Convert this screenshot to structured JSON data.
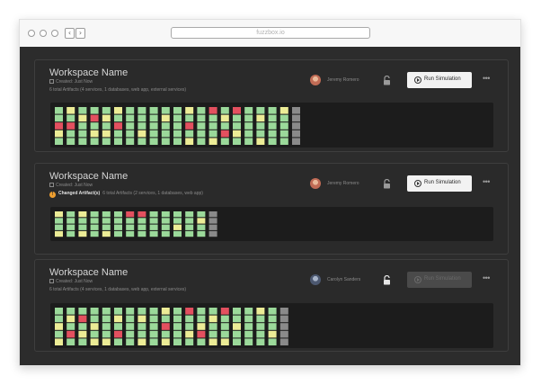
{
  "browser": {
    "url": "fuzzbox.io",
    "back_glyph": "‹",
    "forward_glyph": "›"
  },
  "colors": {
    "green": "#9bd99a",
    "yellow": "#ecec96",
    "red": "#e3505f",
    "gray": "#8a8a8a",
    "button_bg": "#f2f2f2",
    "content_bg": "#2c2c2c"
  },
  "icons": {
    "calendar": "calendar-icon",
    "lock": "lock-icon",
    "play": "play-icon",
    "more": "more-icon",
    "warning": "warning-icon"
  },
  "workspaces": [
    {
      "title": "Workspace Name",
      "created": "Created: Just Now",
      "changed_badge": "",
      "changed_label": "",
      "artifacts": "6 total Artifacts (4 services, 1 databases, web app, external services)",
      "user_name": "Jeremy Romero",
      "lock_state": "unlocked",
      "run_label": "Run Simulation",
      "run_enabled": true,
      "more_label": "•••",
      "columns": [
        "GGRYG",
        "YGRGG",
        "GYGGG",
        "GRGYG",
        "GYGYG",
        "YGRGG",
        "GGGGG",
        "GGGYG",
        "GGGGG",
        "GYGGG",
        "GGGGG",
        "YGRGY",
        "GGGGG",
        "RGGGY",
        "GYGRG",
        "RGGYG",
        "GGGGG",
        "GYGGY",
        "GGGGG",
        "YGGGG",
        "AAAAA"
      ]
    },
    {
      "title": "Workspace Name",
      "created": "Created: Just Now",
      "changed_badge": "!",
      "changed_label": "Changed Artifact(s)",
      "artifacts": "6 total Artifacts (2 services, 1 databases, web app)",
      "user_name": "Jeremy Romero",
      "lock_state": "unlocked",
      "run_label": "Run Simulation",
      "run_enabled": true,
      "more_label": "•••",
      "columns": [
        "YGGY",
        "GGGG",
        "YGGY",
        "GGGG",
        "GGGY",
        "GGGG",
        "RGGG",
        "RGGG",
        "GGGG",
        "GGGG",
        "GGYG",
        "GGGG",
        "GYGG",
        "AAAA"
      ]
    },
    {
      "title": "Workspace Name",
      "created": "Created: Just Now",
      "changed_badge": "",
      "changed_label": "",
      "artifacts": "6 total Artifacts (4 services, 1 databases, web app, external services)",
      "user_name": "Carolyn Sanders",
      "lock_state": "locked",
      "run_label": "Run Simulation",
      "run_enabled": false,
      "more_label": "•••",
      "columns": [
        "GGYGY",
        "GYGRG",
        "GRGYG",
        "GGYGY",
        "GGGGY",
        "GYGRG",
        "GGGGG",
        "GYGGY",
        "GGGGG",
        "YGRGY",
        "GGGGG",
        "RGGYG",
        "GGYRG",
        "GYGGY",
        "RGGGY",
        "GGYGG",
        "GGGGG",
        "YGGGG",
        "GGGYG",
        "AAAAA"
      ]
    }
  ]
}
